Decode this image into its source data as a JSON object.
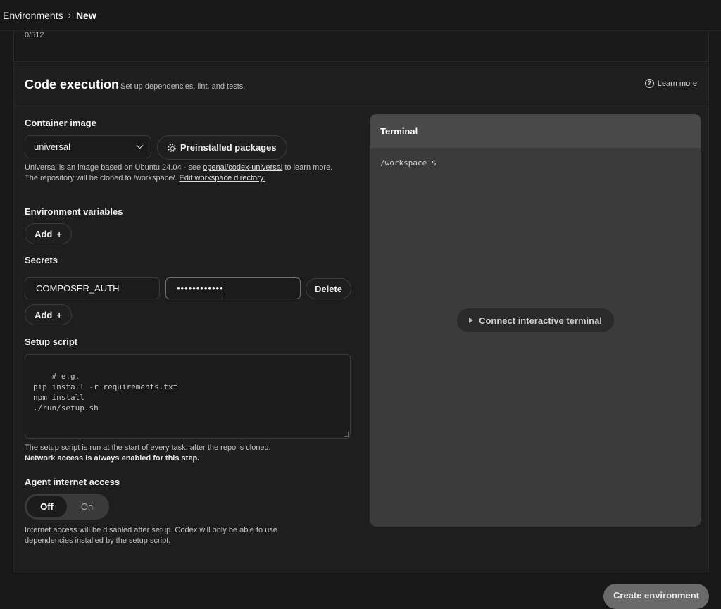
{
  "breadcrumb": {
    "parent": "Environments",
    "separator": "›",
    "current": "New"
  },
  "previous_section": {
    "char_counter": "0/512"
  },
  "code_execution": {
    "title": "Code execution",
    "subtitle": "Set up dependencies, lint, and tests.",
    "learn_more": "Learn more",
    "container_image": {
      "label": "Container image",
      "selected": "universal",
      "preinstalled_button": "Preinstalled packages",
      "help_prefix": "Universal is an image based on Ubuntu 24.04 - see",
      "help_link": "openai/codex-universal",
      "help_suffix": "to learn more.",
      "help_line2_prefix": "The repository will be cloned to /workspace/.",
      "help_line2_link": "Edit workspace directory."
    },
    "env_vars": {
      "label": "Environment variables",
      "add_button": "Add",
      "add_icon": "+"
    },
    "secrets": {
      "label": "Secrets",
      "items": [
        {
          "name": "COMPOSER_AUTH",
          "value_masked": "••••••••••••"
        }
      ],
      "delete_button": "Delete",
      "add_button": "Add",
      "add_icon": "+"
    },
    "setup_script": {
      "label": "Setup script",
      "placeholder": "# e.g.\npip install -r requirements.txt\nnpm install\n./run/setup.sh",
      "help_line1": "The setup script is run at the start of every task, after the repo is cloned.",
      "help_line2": "Network access is always enabled for this step."
    },
    "agent_internet": {
      "label": "Agent internet access",
      "options": [
        "Off",
        "On"
      ],
      "selected": "Off",
      "help_line1": "Internet access will be disabled after setup. Codex will only be able to use",
      "help_line2": "dependencies installed by the setup script."
    },
    "terminal": {
      "title": "Terminal",
      "prompt": "/workspace $",
      "connect_button": "Connect interactive terminal"
    }
  },
  "footer": {
    "create_button": "Create environment"
  }
}
